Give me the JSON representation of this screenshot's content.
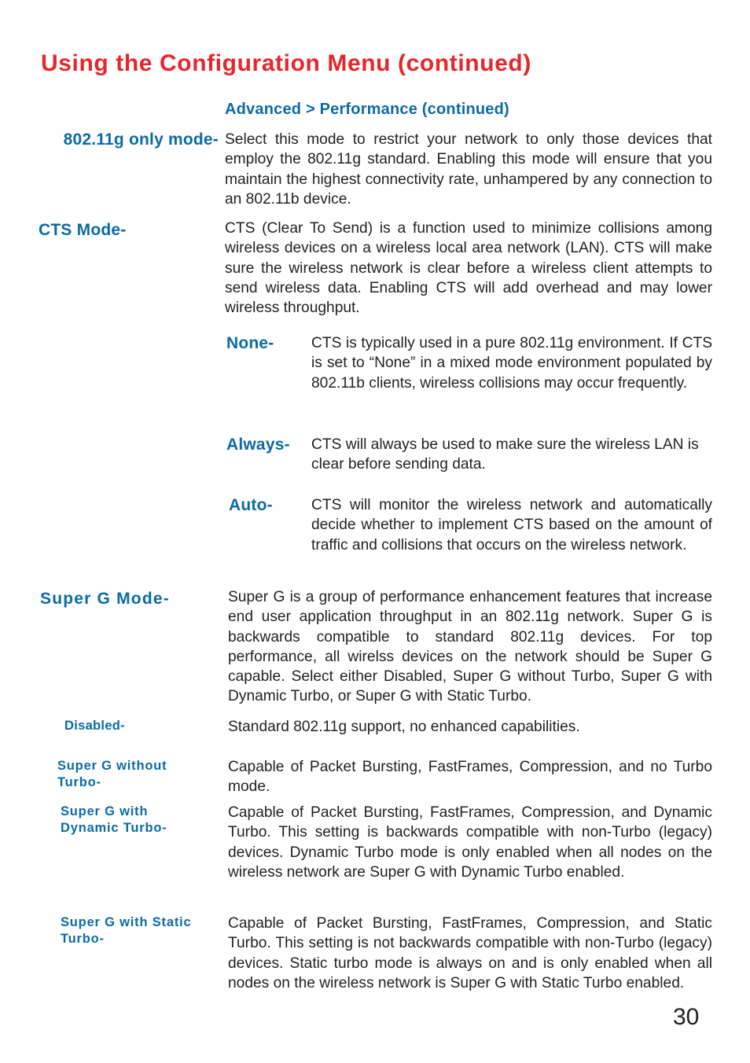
{
  "document": {
    "title": "Using the Configuration Menu (continued)",
    "section_heading": "Advanced > Performance (continued)",
    "page_number": "30",
    "colors": {
      "title_red": "#e8252c",
      "term_blue": "#0a6ba4",
      "body_black": "#231f20"
    }
  },
  "entries": [
    {
      "term": "802.11g only mode-",
      "description": "Select this mode to restrict your network to only those devices that employ the 802.11g standard. Enabling this mode will ensure that you maintain the highest connectivity rate, unhampered by any connection to an 802.11b device."
    },
    {
      "term": "CTS Mode-",
      "description": "CTS (Clear To Send) is a function used to minimize collisions among wireless devices on a wireless local area network (LAN). CTS will make sure the wireless network is clear before a wireless client attempts to send wireless data. Enabling CTS will add overhead and may lower wireless throughput."
    },
    {
      "term": "None-",
      "description": "CTS is typically used in a pure 802.11g environment. If CTS is set to “None” in a mixed mode environment populated by 802.11b clients, wireless collisions may occur frequently."
    },
    {
      "term": "Always-",
      "description": "CTS will always be used to make sure the wireless LAN is clear before sending data."
    },
    {
      "term": "Auto-",
      "description": "CTS will monitor the wireless network and automatically decide whether to implement CTS based on the amount of traffic and collisions that occurs on the wireless network."
    },
    {
      "term": "Super G Mode-",
      "description": "Super G is a group of performance enhancement features that increase end user application throughput in an 802.11g network. Super G is backwards compatible to standard 802.11g devices. For top performance, all wirelss devices on the network should be Super G capable. Select either Disabled, Super G without Turbo, Super G with Dynamic Turbo, or Super G with Static Turbo."
    },
    {
      "term": "Disabled-",
      "description": "Standard 802.11g support, no enhanced capabilities."
    },
    {
      "term": "Super G without Turbo-",
      "description": "Capable of Packet Bursting, FastFrames, Compression, and no Turbo mode."
    },
    {
      "term": "Super G with Dynamic Turbo-",
      "description": "Capable of Packet Bursting, FastFrames, Compression, and Dynamic Turbo. This setting is backwards compatible with non-Turbo (legacy) devices. Dynamic Turbo mode is only enabled when all nodes on the wireless network are Super G with Dynamic Turbo enabled."
    },
    {
      "term": "Super G with Static Turbo-",
      "description": "Capable of Packet Bursting, FastFrames, Compression, and Static Turbo. This setting is not backwards compatible with non-Turbo (legacy) devices. Static turbo mode is always on and is only enabled when all nodes on the wireless network is Super G with Static Turbo enabled."
    }
  ]
}
